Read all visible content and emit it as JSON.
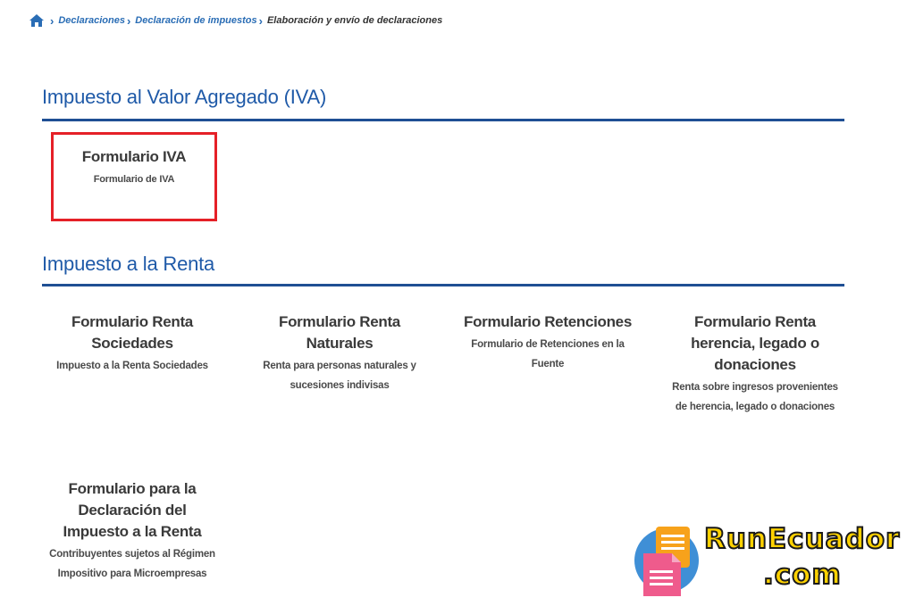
{
  "breadcrumb": {
    "home_icon": "home-icon",
    "items": [
      "Declaraciones",
      "Declaración de impuestos"
    ],
    "current": "Elaboración y envío de declaraciones"
  },
  "sections": {
    "iva": {
      "title": "Impuesto al Valor Agregado (IVA)",
      "cards": [
        {
          "title": "Formulario IVA",
          "desc": "Formulario de IVA"
        }
      ]
    },
    "renta": {
      "title": "Impuesto a la Renta",
      "cards": [
        {
          "title": "Formulario Renta Sociedades",
          "desc": "Impuesto a la Renta Sociedades"
        },
        {
          "title": "Formulario Renta Naturales",
          "desc": "Renta para personas naturales y sucesiones indivisas"
        },
        {
          "title": "Formulario Retenciones",
          "desc": "Formulario de Retenciones en la Fuente"
        },
        {
          "title": "Formulario Renta herencia, legado o donaciones",
          "desc": "Renta sobre ingresos provenientes de herencia, legado o donaciones"
        },
        {
          "title": "Formulario para la Declaración del Impuesto a la Renta",
          "desc": "Contribuyentes sujetos al Régimen Impositivo para Microempresas"
        }
      ]
    }
  },
  "watermark": {
    "brand": "RunEcuador",
    "tld": ".com"
  },
  "colors": {
    "link": "#2a6db5",
    "section_title": "#1f5aa8",
    "rule": "#1f4f94",
    "highlight": "#e52027",
    "watermark_text": "#ffd200"
  }
}
